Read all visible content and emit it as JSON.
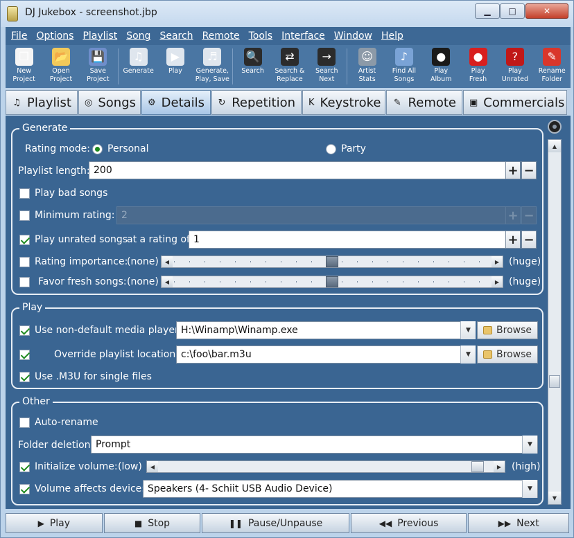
{
  "window": {
    "title": "DJ Jukebox - screenshot.jbp"
  },
  "menu": [
    "File",
    "Options",
    "Playlist",
    "Song",
    "Search",
    "Remote",
    "Tools",
    "Interface",
    "Window",
    "Help"
  ],
  "toolbar": [
    {
      "label": "New\nProject",
      "icon": "new-project-icon",
      "color": "#f4f4f4"
    },
    {
      "label": "Open\nProject",
      "icon": "open-folder-icon",
      "color": "#f2c95a"
    },
    {
      "label": "Save\nProject",
      "icon": "save-disk-icon",
      "color": "#6f8ecb"
    },
    {
      "label": "Generate",
      "icon": "generate-icon",
      "color": "#dfe6ee"
    },
    {
      "label": "Play",
      "icon": "play-playlist-icon",
      "color": "#dfe6ee"
    },
    {
      "label": "Generate,\nPlay, Save",
      "icon": "generate-play-save-icon",
      "color": "#dfe6ee"
    },
    {
      "label": "Search",
      "icon": "binoculars-icon",
      "color": "#2b2b2b"
    },
    {
      "label": "Search &\nReplace",
      "icon": "search-replace-icon",
      "color": "#2b2b2b"
    },
    {
      "label": "Search\nNext",
      "icon": "search-next-icon",
      "color": "#2b2b2b"
    },
    {
      "label": "Artist\nStats",
      "icon": "artist-stats-icon",
      "color": "#8c9aa8"
    },
    {
      "label": "Find All\nSongs",
      "icon": "find-all-songs-icon",
      "color": "#7aa3d6"
    },
    {
      "label": "Play\nAlbum",
      "icon": "play-album-icon",
      "color": "#1a1a1a"
    },
    {
      "label": "Play\nFresh",
      "icon": "apple-icon",
      "color": "#d81f1f"
    },
    {
      "label": "Play\nUnrated",
      "icon": "unrated-icon",
      "color": "#c01818"
    },
    {
      "label": "Rename\nFolder",
      "icon": "rename-folder-icon",
      "color": "#d9362b"
    }
  ],
  "tabs": [
    {
      "label": "Playlist",
      "icon": "playlist-icon",
      "active": false
    },
    {
      "label": "Songs",
      "icon": "disc-icon",
      "active": false
    },
    {
      "label": "Details",
      "icon": "gear-icon",
      "active": true
    },
    {
      "label": "Repetition",
      "icon": "repeat-icon",
      "active": false
    },
    {
      "label": "Keystroke",
      "icon": "keystroke-icon",
      "active": false
    },
    {
      "label": "Remote",
      "icon": "remote-icon",
      "active": false
    },
    {
      "label": "Commercials",
      "icon": "tv-icon",
      "active": false
    }
  ],
  "generate": {
    "title": "Generate",
    "rating_mode_label": "Rating mode:",
    "personal": "Personal",
    "party": "Party",
    "rating_mode_value": "Personal",
    "playlist_length_label": "Playlist length:",
    "playlist_length": "200",
    "play_bad_songs": "Play bad songs",
    "play_bad_songs_checked": false,
    "minimum_rating_label": "Minimum rating:",
    "minimum_rating_checked": false,
    "minimum_rating": "2",
    "play_unrated_label": "Play unrated songs",
    "play_unrated_checked": true,
    "at_rating_label": "at a rating of",
    "at_rating": "1",
    "rating_importance_label": "Rating importance:",
    "rating_importance_checked": false,
    "rating_importance_level": 0.5,
    "favor_fresh_label": "Favor fresh songs:",
    "favor_fresh_checked": false,
    "favor_fresh_level": 0.5,
    "none_label": "(none)",
    "huge_label": "(huge)"
  },
  "play": {
    "title": "Play",
    "nondefault_label": "Use non-default media player:",
    "nondefault_checked": true,
    "player_path": "H:\\Winamp\\Winamp.exe",
    "override_label": "Override playlist location:",
    "override_checked": true,
    "playlist_path": "c:\\foo\\bar.m3u",
    "m3u_label": "Use .M3U for single files",
    "m3u_checked": true,
    "browse": "Browse"
  },
  "other": {
    "title": "Other",
    "auto_rename": "Auto-rename",
    "auto_rename_checked": false,
    "folder_deletion_label": "Folder deletion:",
    "folder_deletion": "Prompt",
    "init_volume_label": "Initialize volume:",
    "init_volume_checked": true,
    "init_volume_level": 0.97,
    "low_label": "(low)",
    "high_label": "(high)",
    "volume_device_label": "Volume affects device:",
    "volume_device_checked": true,
    "volume_device": "Speakers (4- Schiit USB Audio Device)"
  },
  "controls": [
    {
      "label": "Play",
      "icon": "play-icon",
      "glyph": "▶"
    },
    {
      "label": "Stop",
      "icon": "stop-icon",
      "glyph": "■"
    },
    {
      "label": "Pause/Unpause",
      "icon": "pause-icon",
      "glyph": "❚❚"
    },
    {
      "label": "Previous",
      "icon": "previous-icon",
      "glyph": "◀◀"
    },
    {
      "label": "Next",
      "icon": "next-icon",
      "glyph": "▶▶"
    }
  ]
}
